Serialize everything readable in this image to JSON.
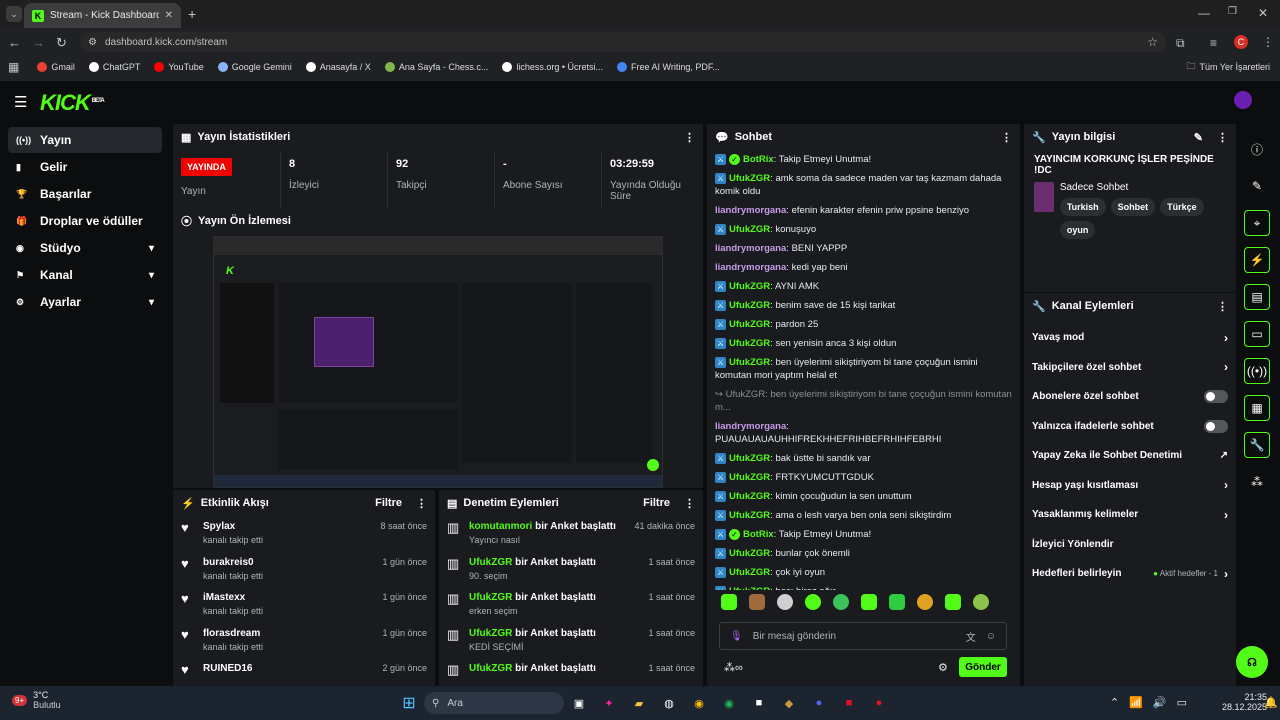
{
  "browser": {
    "tab_title": "Stream - Kick Dashboard",
    "url": "dashboard.kick.com/stream",
    "profile_initial": "C",
    "bookmarks": [
      {
        "label": "Gmail",
        "color": "#ea4335"
      },
      {
        "label": "ChatGPT",
        "color": "#ffffff"
      },
      {
        "label": "YouTube",
        "color": "#ff0000"
      },
      {
        "label": "Google Gemini",
        "color": "#8ab4f8"
      },
      {
        "label": "Anasayfa / X",
        "color": "#ffffff"
      },
      {
        "label": "Ana Sayfa - Chess.c...",
        "color": "#81b64c"
      },
      {
        "label": "lichess.org • Ücretsi...",
        "color": "#ffffff"
      },
      {
        "label": "Free AI Writing, PDF...",
        "color": "#4285f4"
      }
    ],
    "all_bookmarks": "Tüm Yer İşaretleri"
  },
  "kick": {
    "logo": "KICK",
    "logo_badge": "BETA",
    "nav": [
      {
        "label": "Yayın",
        "icon": "live-icon",
        "active": true,
        "chevron": false
      },
      {
        "label": "Gelir",
        "icon": "income-icon",
        "chevron": false
      },
      {
        "label": "Başarılar",
        "icon": "trophy-icon",
        "chevron": false
      },
      {
        "label": "Droplar ve ödüller",
        "icon": "gift-icon",
        "chevron": false
      },
      {
        "label": "Stüdyo",
        "icon": "studio-icon",
        "chevron": true
      },
      {
        "label": "Kanal",
        "icon": "channel-icon",
        "chevron": true
      },
      {
        "label": "Ayarlar",
        "icon": "settings-icon",
        "chevron": true
      }
    ]
  },
  "stats": {
    "title": "Yayın İstatistikleri",
    "live_badge": "YAYINDA",
    "items": [
      {
        "value": "",
        "label": "Yayın"
      },
      {
        "value": "8",
        "label": "İzleyici"
      },
      {
        "value": "92",
        "label": "Takipçi"
      },
      {
        "value": "-",
        "label": "Abone Sayısı"
      },
      {
        "value": "03:29:59",
        "label": "Yayında Olduğu Süre"
      }
    ]
  },
  "preview": {
    "title": "Yayın Ön İzlemesi"
  },
  "activity": {
    "title": "Etkinlik Akışı",
    "filter": "Filtre",
    "items": [
      {
        "name": "Spylax",
        "sub": "kanalı takip etti",
        "time": "8 saat önce"
      },
      {
        "name": "burakreis0",
        "sub": "kanalı takip etti",
        "time": "1 gün önce"
      },
      {
        "name": "iMastexx",
        "sub": "kanalı takip etti",
        "time": "1 gün önce"
      },
      {
        "name": "florasdream",
        "sub": "kanalı takip etti",
        "time": "1 gün önce"
      },
      {
        "name": "RUINED16",
        "sub": "",
        "time": "2 gün önce"
      }
    ]
  },
  "moderation": {
    "title": "Denetim Eylemleri",
    "filter": "Filtre",
    "items": [
      {
        "user": "komutanmori",
        "action": "bir Anket başlattı",
        "sub": "Yayıncı nasıl",
        "time": "41 dakika önce"
      },
      {
        "user": "UfukZGR",
        "action": "bir Anket başlattı",
        "sub": "90. seçim",
        "time": "1 saat önce"
      },
      {
        "user": "UfukZGR",
        "action": "bir Anket başlattı",
        "sub": "erken seçim",
        "time": "1 saat önce"
      },
      {
        "user": "UfukZGR",
        "action": "bir Anket başlattı",
        "sub": "KEDİ SEÇİMİ",
        "time": "1 saat önce"
      },
      {
        "user": "UfukZGR",
        "action": "bir Anket başlattı",
        "sub": "",
        "time": "1 saat önce"
      }
    ]
  },
  "chat": {
    "title": "Sohbet",
    "messages": [
      {
        "user": "BotRix",
        "text": "Takip Etmeyi Unutma!",
        "kind": "bot"
      },
      {
        "user": "UfukZGR",
        "text": "amk soma da sadece maden var taş kazmam dahada komik oldu",
        "kind": "mod"
      },
      {
        "user": "liandrymorgana",
        "text": "efenin karakter efenin priw ppsine benziyo",
        "kind": "viewer"
      },
      {
        "user": "UfukZGR",
        "text": "konuşuyo",
        "kind": "mod"
      },
      {
        "user": "liandrymorgana",
        "text": "BENI YAPPP",
        "kind": "viewer"
      },
      {
        "user": "liandrymorgana",
        "text": "kedi yap beni",
        "kind": "viewer"
      },
      {
        "user": "UfukZGR",
        "text": "AYNI AMK",
        "kind": "mod"
      },
      {
        "user": "UfukZGR",
        "text": "benim save de 15 kişi tarikat",
        "kind": "mod"
      },
      {
        "user": "UfukZGR",
        "text": "pardon 25",
        "kind": "mod"
      },
      {
        "user": "UfukZGR",
        "text": "sen yenisin anca 3 kişi oldun",
        "kind": "mod"
      },
      {
        "user": "UfukZGR",
        "text": "ben üyelerimi sikiştiriyom bi tane çoçuğun ismini komutan mori yaptım helal et",
        "kind": "mod"
      },
      {
        "user": "",
        "text": "↪ UfukZGR: ben üyelerimi sikiştiriyom bi tane çoçuğun ismini komutan m...",
        "kind": "reply"
      },
      {
        "user": "liandrymorgana",
        "text": "PUAUAUAUAUHHIFREKHHEFRIHBEFRHIHFEBRHI",
        "kind": "viewer"
      },
      {
        "user": "UfukZGR",
        "text": "bak üstte bi sandık var",
        "kind": "mod"
      },
      {
        "user": "UfukZGR",
        "text": "FRTKYUMCUTTGDUK",
        "kind": "mod"
      },
      {
        "user": "UfukZGR",
        "text": "kimin çocuğudun la sen unuttum",
        "kind": "mod"
      },
      {
        "user": "UfukZGR",
        "text": "ama o lesh varya ben onla seni sikiştirdim",
        "kind": "mod"
      },
      {
        "user": "BotRix",
        "text": "Takip Etmeyi Unutma!",
        "kind": "bot"
      },
      {
        "user": "UfukZGR",
        "text": "bunlar çok önemli",
        "kind": "mod"
      },
      {
        "user": "UfukZGR",
        "text": "çok iyi oyun",
        "kind": "mod"
      },
      {
        "user": "UfukZGR",
        "text": "başı biraz ağır",
        "kind": "mod"
      }
    ],
    "placeholder": "Bir mesaj gönderin",
    "send": "Gönder"
  },
  "stream_info": {
    "title": "Yayın bilgisi",
    "stream_title": "YAYINCIM KORKUNÇ İŞLER PEŞİNDE !DC",
    "category": "Sadece Sohbet",
    "tags": [
      "Turkish",
      "Sohbet",
      "Türkçe",
      "oyun"
    ]
  },
  "channel_actions": {
    "title": "Kanal Eylemleri",
    "items": [
      {
        "label": "Yavaş mod",
        "control": "chevron"
      },
      {
        "label": "Takipçilere özel sohbet",
        "control": "chevron"
      },
      {
        "label": "Abonelere özel sohbet",
        "control": "toggle"
      },
      {
        "label": "Yalnızca ifadelerle sohbet",
        "control": "toggle"
      },
      {
        "label": "Yapay Zeka ile Sohbet Denetimi",
        "control": "external"
      },
      {
        "label": "Hesap yaşı kısıtlaması",
        "control": "chevron"
      },
      {
        "label": "Yasaklanmış kelimeler",
        "control": "chevron"
      },
      {
        "label": "İzleyici Yönlendir",
        "control": "none"
      },
      {
        "label": "Hedefleri belirleyin",
        "control": "goal",
        "extra": "Aktif hedefler - 1"
      }
    ]
  },
  "taskbar": {
    "weather_temp": "3°C",
    "weather_desc": "Bulutlu",
    "weather_badge": "9+",
    "search": "Ara",
    "time": "21:35",
    "date": "28.12.2025"
  },
  "colors": {
    "accent": "#53fc18",
    "live": "#eb0400",
    "panel": "#191b1f",
    "bg": "#0b0d0e"
  }
}
